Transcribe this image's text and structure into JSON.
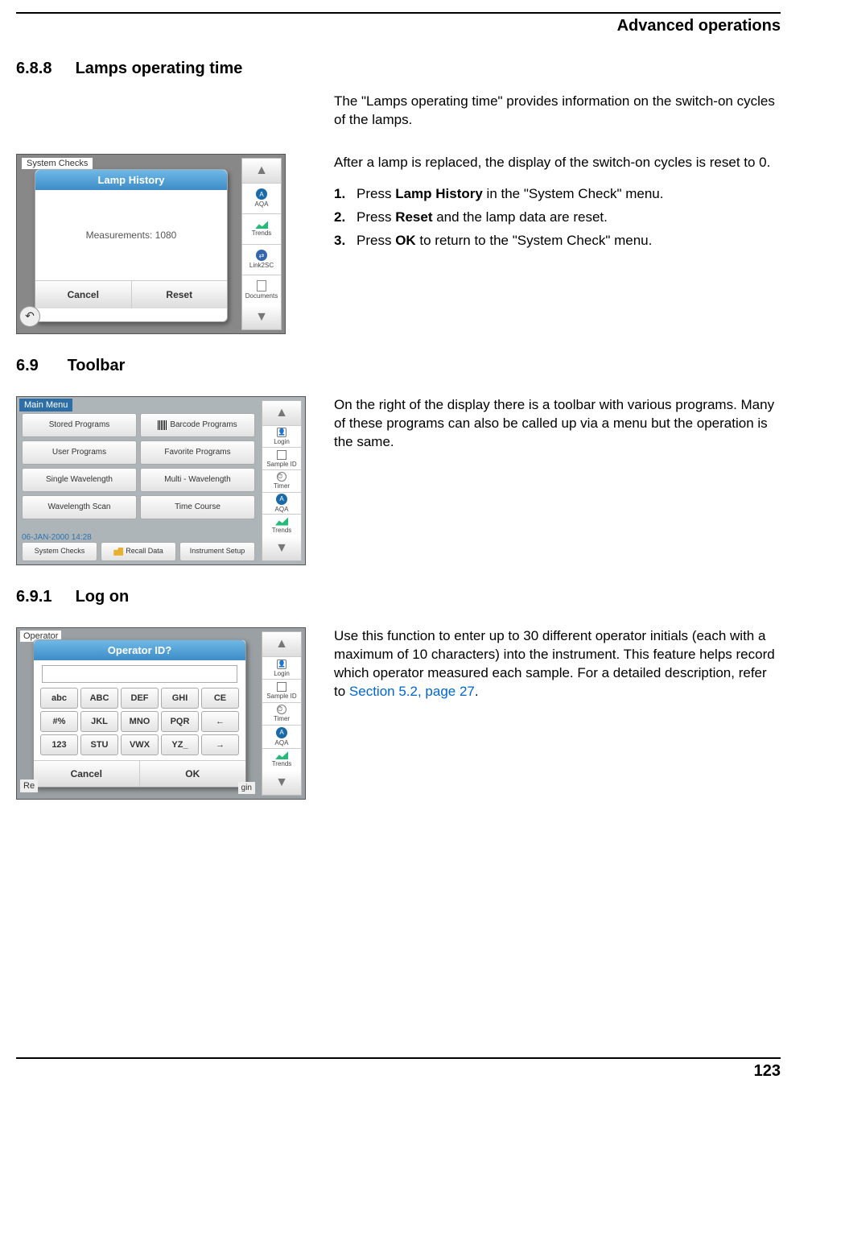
{
  "header": {
    "chapter": "Advanced operations"
  },
  "s688": {
    "num": "6.8.8",
    "title": "Lamps operating time",
    "intro": "The \"Lamps operating time\" provides information on the switch-on cycles of the lamps.",
    "para1": "After a lamp is replaced, the display of the switch-on cycles is reset to 0.",
    "steps": [
      {
        "n": "1.",
        "pre": "Press ",
        "b": "Lamp History",
        "post": " in the \"System Check\" menu."
      },
      {
        "n": "2.",
        "pre": "Press ",
        "b": "Reset",
        "post": " and the lamp data are reset."
      },
      {
        "n": "3.",
        "pre": "Press ",
        "b": "OK",
        "post": " to return to the \"System Check\" menu."
      }
    ],
    "ss": {
      "bgTitle": "System Checks",
      "popupTitle": "Lamp History",
      "body": "Measurements:  1080",
      "cancel": "Cancel",
      "reset": "Reset",
      "side": {
        "aqa": "AQA",
        "trends": "Trends",
        "link": "Link2SC",
        "docs": "Documents"
      }
    }
  },
  "s69": {
    "num": "6.9",
    "title": "Toolbar",
    "para": "On the right of the display there is a toolbar with various programs. Many of these programs can also be called up via a menu but the operation is the same.",
    "ss": {
      "title": "Main Menu",
      "cells": [
        "Stored Programs",
        "Barcode Programs",
        "User Programs",
        "Favorite Programs",
        "Single Wavelength",
        "Multi - Wavelength",
        "Wavelength Scan",
        "Time Course"
      ],
      "date": "06-JAN-2000  14:28",
      "bottom": [
        "System Checks",
        "Recall Data",
        "Instrument Setup"
      ],
      "side": {
        "login": "Login",
        "sample": "Sample ID",
        "timer": "Timer",
        "aqa": "AQA",
        "trends": "Trends"
      }
    }
  },
  "s691": {
    "num": "6.9.1",
    "title": "Log on",
    "para_pre": "Use this function to enter up to 30 different operator initials (each with a maximum of 10 characters) into the instrument. This feature helps record which operator measured each sample. For a detailed description, refer to ",
    "link": "Section 5.2, page 27",
    "para_post": ".",
    "ss": {
      "bg": "Operator",
      "title": "Operator ID?",
      "keys": [
        "abc",
        "ABC",
        "DEF",
        "GHI",
        "CE",
        "#%",
        "JKL",
        "MNO",
        "PQR",
        "←",
        "123",
        "STU",
        "VWX",
        "YZ_",
        "→"
      ],
      "cancel": "Cancel",
      "ok": "OK",
      "re": "Re",
      "loginTail": "gin",
      "side": {
        "login": "Login",
        "sample": "Sample ID",
        "timer": "Timer",
        "aqa": "AQA",
        "trends": "Trends"
      }
    }
  },
  "pageNumber": "123"
}
